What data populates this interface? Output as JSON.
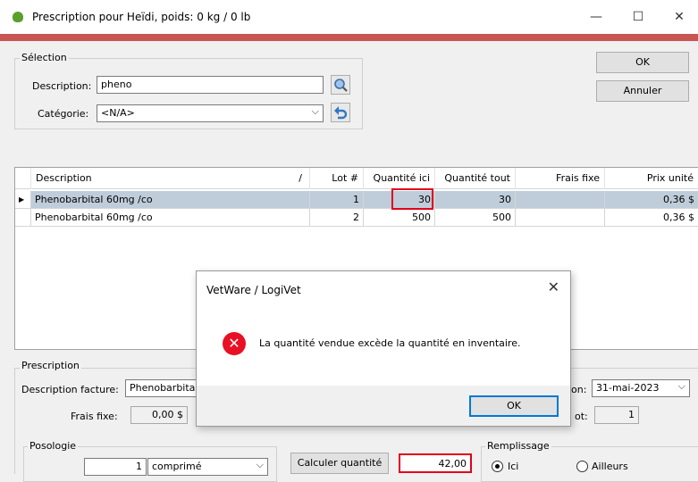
{
  "window": {
    "title": "Prescription pour Heïdi, poids: 0 kg / 0 lb",
    "minimize": "—",
    "maximize": "☐",
    "close": "✕",
    "accent_color": "#c95652"
  },
  "selection": {
    "group_label": "Sélection",
    "description_label": "Description:",
    "description_value": "pheno",
    "category_label": "Catégorie:",
    "category_value": "<N/A>",
    "search_icon": "magnifier-icon",
    "reset_icon": "undo-arrow-icon"
  },
  "buttons": {
    "ok": "OK",
    "cancel": "Annuler"
  },
  "grid": {
    "columns": [
      "Description",
      "Lot #",
      "Quantité ici",
      "Quantité tout",
      "Frais fixe",
      "Prix unité"
    ],
    "sort_indicator": "/",
    "row_indicator": "▶",
    "rows": [
      {
        "description": "Phenobarbital 60mg /co",
        "lot": "1",
        "qty_here": "30",
        "qty_all": "30",
        "fixed_fee": "",
        "unit_price": "0,36 $"
      },
      {
        "description": "Phenobarbital 60mg /co",
        "lot": "2",
        "qty_here": "500",
        "qty_all": "500",
        "fixed_fee": "",
        "unit_price": "0,36 $"
      }
    ],
    "selected_row_color": "#bfcddb"
  },
  "prescription": {
    "group_label": "Prescription",
    "invoice_desc_label": "Description facture:",
    "invoice_desc_value": "Phenobarbita",
    "fixed_fee_label": "Frais fixe:",
    "fixed_fee_value": "0,00 $",
    "date_label_partial": "on:",
    "date_value": "31-mai-2023",
    "lot_label_partial": "ot:",
    "lot_value": "1"
  },
  "posology": {
    "group_label": "Posologie",
    "quantity_value": "1",
    "unit_value": "comprimé"
  },
  "calculate": {
    "button_label": "Calculer quantité",
    "quantity_value": "42,00"
  },
  "filling": {
    "group_label": "Remplissage",
    "option_here": "Ici",
    "option_elsewhere": "Ailleurs",
    "selected": "Ici"
  },
  "dialog": {
    "title": "VetWare / LogiVet",
    "close": "✕",
    "message": "La quantité vendue excède la quantité en inventaire.",
    "ok": "OK",
    "icon": "error-icon",
    "icon_glyph": "✕",
    "icon_color": "#e81123"
  },
  "highlight_color": "#e0001b"
}
